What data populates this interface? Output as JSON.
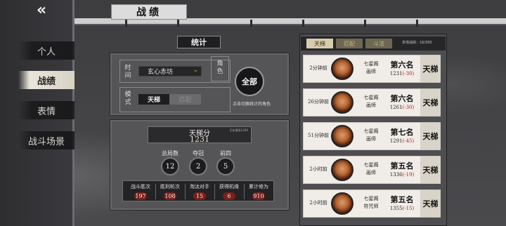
{
  "nav": {
    "back_icon": "back-arrow-icon",
    "title": "战绩",
    "items": [
      {
        "label": "个人",
        "active": false
      },
      {
        "label": "战绩",
        "active": true
      },
      {
        "label": "表情",
        "active": false
      },
      {
        "label": "战斗场景",
        "active": false
      }
    ]
  },
  "stats": {
    "tab_label": "统计",
    "time_label": "时间",
    "mode_label": "模式",
    "role_label": "角色",
    "time_select": "玄心赤坊",
    "mode_on": "天梯",
    "mode_off": "匹配",
    "all_button": "全部",
    "role_hint": "点击切换统计的角色",
    "ladder": {
      "title": "天梯分",
      "sub": "历史最高1289",
      "score": "1231"
    },
    "counts": [
      {
        "label": "总局数",
        "value": "12"
      },
      {
        "label": "夺冠",
        "value": "2"
      },
      {
        "label": "前四",
        "value": "5"
      }
    ],
    "strip": [
      {
        "label": "战斗胜次",
        "value": "197"
      },
      {
        "label": "胜利轮次",
        "value": "108"
      },
      {
        "label": "淘汰对手",
        "value": "15"
      },
      {
        "label": "获得机缘",
        "value": "6"
      },
      {
        "label": "累计修为",
        "value": "910"
      }
    ]
  },
  "history": {
    "tabs": [
      {
        "label": "天梯",
        "active": true
      },
      {
        "label": "匹配",
        "active": false
      },
      {
        "label": "斗法",
        "active": false
      }
    ],
    "count": "本地战绩：16/300",
    "records": [
      {
        "time": "2分钟前",
        "role_line1": "七星阁",
        "role_line2": "画师",
        "rank": "第六名",
        "score": "1231",
        "delta": "(-30)",
        "mode": "天梯"
      },
      {
        "time": "26分钟前",
        "role_line1": "七星阁",
        "role_line2": "画师",
        "rank": "第六名",
        "score": "1261",
        "delta": "(-30)",
        "mode": "天梯"
      },
      {
        "time": "51分钟前",
        "role_line1": "七星阁",
        "role_line2": "画师",
        "rank": "第七名",
        "score": "1291",
        "delta": "(-45)",
        "mode": "天梯"
      },
      {
        "time": "2小时前",
        "role_line1": "七星阁",
        "role_line2": "画师",
        "rank": "第五名",
        "score": "1336",
        "delta": "(-19)",
        "mode": "天梯"
      },
      {
        "time": "2小时前",
        "role_line1": "七星阁",
        "role_line2": "符咒师",
        "rank": "第五名",
        "score": "1355",
        "delta": "(-15)",
        "mode": "天梯"
      }
    ]
  }
}
